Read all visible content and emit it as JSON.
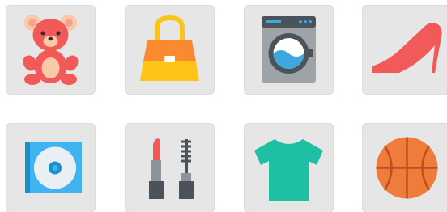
{
  "grid": {
    "tiles": [
      {
        "icon": "teddy-bear-icon"
      },
      {
        "icon": "handbag-icon"
      },
      {
        "icon": "washing-machine-icon"
      },
      {
        "icon": "high-heel-shoe-icon"
      },
      {
        "icon": "cd-disc-icon"
      },
      {
        "icon": "lipstick-mascara-icon"
      },
      {
        "icon": "t-shirt-icon"
      },
      {
        "icon": "basketball-icon"
      }
    ]
  },
  "colors": {
    "tile_background": "#e6e6e6",
    "page_background": "#ffffff",
    "bear_red": "#f25a5a",
    "bear_peach": "#f9c9a8",
    "bag_orange": "#f98a2f",
    "bag_yellow": "#fcc417",
    "washer_gray": "#9ea3a8",
    "washer_dark": "#4b5259",
    "washer_blue": "#3fa7e0",
    "shoe_red": "#f25a5a",
    "cd_blue": "#3fb4f0",
    "tshirt_teal": "#1fbfa4",
    "ball_orange": "#f07c3b"
  }
}
